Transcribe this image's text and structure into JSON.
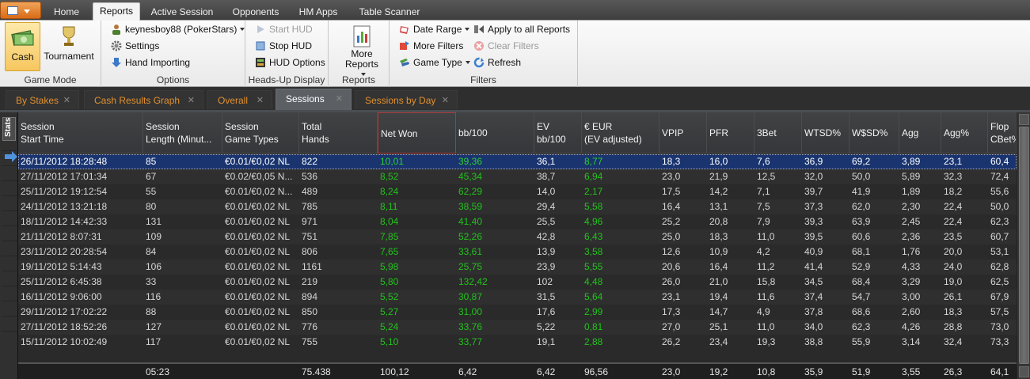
{
  "menu_tabs": [
    "Home",
    "Reports",
    "Active Session",
    "Opponents",
    "HM Apps",
    "Table Scanner"
  ],
  "ribbon": {
    "game_mode": {
      "label": "Game Mode",
      "cash": "Cash",
      "tournament": "Tournament"
    },
    "options": {
      "label": "Options",
      "player": "keynesboy88 (PokerStars)",
      "settings": "Settings",
      "hand_importing": "Hand Importing"
    },
    "hud": {
      "label": "Heads-Up Display",
      "start": "Start HUD",
      "stop": "Stop HUD",
      "options": "HUD Options"
    },
    "reports": {
      "label": "Reports",
      "more_line1": "More",
      "more_line2": "Reports"
    },
    "filters": {
      "label": "Filters",
      "date_range": "Date Rarge",
      "more_filters": "More Filters",
      "game_type": "Game Type",
      "apply_all": "Apply to all Reports",
      "clear": "Clear Filters",
      "refresh": "Refresh"
    }
  },
  "doc_tabs": [
    "By Stakes",
    "Cash Results Graph",
    "Overall",
    "Sessions",
    "Sessions by Day"
  ],
  "stats_label": "Stats",
  "columns": [
    [
      "Session",
      "Start Time"
    ],
    [
      "Session",
      "Length (Minut..."
    ],
    [
      "Session",
      "Game Types"
    ],
    [
      "Total",
      "Hands"
    ],
    [
      "Net Won",
      ""
    ],
    [
      "bb/100",
      ""
    ],
    [
      "EV",
      "bb/100"
    ],
    [
      "€ EUR",
      "(EV adjusted)"
    ],
    [
      "VPIP",
      ""
    ],
    [
      "PFR",
      ""
    ],
    [
      "3Bet",
      ""
    ],
    [
      "WTSD%",
      ""
    ],
    [
      "W$SD%",
      ""
    ],
    [
      "Agg",
      ""
    ],
    [
      "Agg%",
      ""
    ],
    [
      "Flop",
      "CBet%"
    ]
  ],
  "rows": [
    [
      "26/11/2012 18:28:48",
      "85",
      "€0.01/€0,02 NL",
      "822",
      "10,01",
      "39,36",
      "36,1",
      "8,77",
      "18,3",
      "16,0",
      "7,6",
      "36,9",
      "69,2",
      "3,89",
      "23,1",
      "60,4"
    ],
    [
      "27/11/2012 17:01:34",
      "67",
      "€0.02/€0,05 N...",
      "536",
      "8,52",
      "45,34",
      "38,7",
      "6,94",
      "23,0",
      "21,9",
      "12,5",
      "32,0",
      "50,0",
      "5,89",
      "32,3",
      "72,4"
    ],
    [
      "25/11/2012 19:12:54",
      "55",
      "€0.01/€0,02 N...",
      "489",
      "8,24",
      "62,29",
      "14,0",
      "2,17",
      "17,5",
      "14,2",
      "7,1",
      "39,7",
      "41,9",
      "1,89",
      "18,2",
      "55,6"
    ],
    [
      "24/11/2012 13:21:18",
      "80",
      "€0.01/€0,02 NL",
      "785",
      "8,11",
      "38,59",
      "29,4",
      "5,58",
      "16,4",
      "13,1",
      "7,5",
      "37,3",
      "62,0",
      "2,30",
      "22,4",
      "50,0"
    ],
    [
      "18/11/2012 14:42:33",
      "131",
      "€0.01/€0,02 NL",
      "971",
      "8,04",
      "41,40",
      "25,5",
      "4,96",
      "25,2",
      "20,8",
      "7,9",
      "39,3",
      "63,9",
      "2,45",
      "22,4",
      "62,3"
    ],
    [
      "21/11/2012 8:07:31",
      "109",
      "€0.01/€0,02 NL",
      "751",
      "7,85",
      "52,26",
      "42,8",
      "6,43",
      "25,0",
      "18,3",
      "11,0",
      "39,5",
      "60,6",
      "2,36",
      "23,5",
      "60,7"
    ],
    [
      "23/11/2012 20:28:54",
      "84",
      "€0.01/€0,02 NL",
      "806",
      "7,65",
      "33,61",
      "13,9",
      "3,58",
      "12,6",
      "10,9",
      "4,2",
      "40,9",
      "68,1",
      "1,76",
      "20,0",
      "53,1"
    ],
    [
      "19/11/2012 5:14:43",
      "106",
      "€0.01/€0,02 NL",
      "1161",
      "5,98",
      "25,75",
      "23,9",
      "5,55",
      "20,6",
      "16,4",
      "11,2",
      "41,4",
      "52,9",
      "4,33",
      "24,0",
      "62,8"
    ],
    [
      "25/11/2012 6:45:38",
      "33",
      "€0.01/€0,02 NL",
      "219",
      "5,80",
      "132,42",
      "102",
      "4,48",
      "26,0",
      "21,0",
      "15,8",
      "34,5",
      "68,4",
      "3,29",
      "19,0",
      "62,5"
    ],
    [
      "16/11/2012 9:06:00",
      "116",
      "€0.01/€0,02 NL",
      "894",
      "5,52",
      "30,87",
      "31,5",
      "5,64",
      "23,1",
      "19,4",
      "11,6",
      "37,4",
      "54,7",
      "3,00",
      "26,1",
      "67,9"
    ],
    [
      "29/11/2012 17:02:22",
      "88",
      "€0.01/€0,02 NL",
      "850",
      "5,27",
      "31,00",
      "17,6",
      "2,99",
      "17,3",
      "14,7",
      "4,9",
      "37,8",
      "68,6",
      "2,60",
      "18,3",
      "57,5"
    ],
    [
      "27/11/2012 18:52:26",
      "127",
      "€0.01/€0,02 NL",
      "776",
      "5,24",
      "33,76",
      "5,22",
      "0,81",
      "27,0",
      "25,1",
      "11,0",
      "34,0",
      "62,3",
      "4,26",
      "28,8",
      "73,0"
    ],
    [
      "15/11/2012 10:02:49",
      "117",
      "€0.01/€0,02 NL",
      "755",
      "5,10",
      "33,77",
      "19,1",
      "2,88",
      "26,2",
      "23,4",
      "19,3",
      "38,8",
      "55,9",
      "3,14",
      "32,4",
      "73,3"
    ]
  ],
  "totals": [
    "",
    "05:23",
    "",
    "75.438",
    "100,12",
    "6,42",
    "6,42",
    "96,56",
    "23,0",
    "19,2",
    "10,8",
    "35,9",
    "51,9",
    "3,55",
    "26,3",
    "64,1"
  ],
  "colors": {
    "positive": "#22c21b",
    "selected_row": "#19346f",
    "tab_active": "#5c6064",
    "tab_text": "#e2902e",
    "game_mode_selected": "#f7c75f"
  },
  "icons": {
    "cash": "money-icon",
    "tournament": "trophy-icon",
    "player": "player-icon",
    "settings": "gear-icon",
    "hand_importing": "download-icon",
    "start_hud": "play-icon",
    "stop_hud": "stop-icon",
    "hud_options": "hud-options-icon",
    "more_reports": "report-icon",
    "date_range": "calendar-icon",
    "more_filters": "filter-icon",
    "game_type": "cards-icon",
    "apply_all": "apply-icon",
    "clear": "clear-icon",
    "refresh": "refresh-icon"
  }
}
